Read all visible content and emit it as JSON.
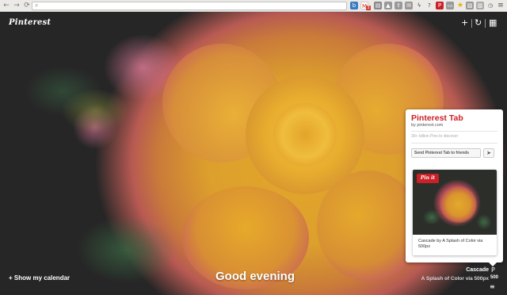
{
  "browser": {
    "back_icon": "back-arrow-icon",
    "forward_icon": "forward-arrow-icon",
    "reload_icon": "reload-icon",
    "omnibox_value": "",
    "extensions": [
      "bitly-icon",
      "gmail-icon",
      "pocket-icon",
      "thumb-up-icon",
      "share-icon",
      "mail-icon",
      "bolt-icon",
      "question-icon",
      "pinterest-ext-icon",
      "cast-icon",
      "star-icon",
      "image-icon",
      "archive-icon",
      "clock-icon",
      "chrome-menu-icon"
    ],
    "gmail_count": "3"
  },
  "header": {
    "brand": "Pinterest",
    "add_icon": "+",
    "refresh_icon": "↻",
    "apps_icon": "▦"
  },
  "bottom": {
    "calendar_link": "+ Show my calendar",
    "greeting": "Good evening",
    "photo_title": "Cascade",
    "photo_credit": "A Splash of Color via 500px",
    "badge_500": "500"
  },
  "popup": {
    "title": "Pinterest Tab",
    "subtitle": "by pinterest.com",
    "tagline": "30+ billion Pins to discover",
    "send_label": "Send Pinterest Tab to friends",
    "pin_label": "Pin it",
    "pin_caption": "Cascade by A Splash of Color via 500px"
  },
  "colors": {
    "pinterest_red": "#cb2027",
    "rose_yellow": "#e2a52a",
    "petal_pink": "#c45668"
  }
}
